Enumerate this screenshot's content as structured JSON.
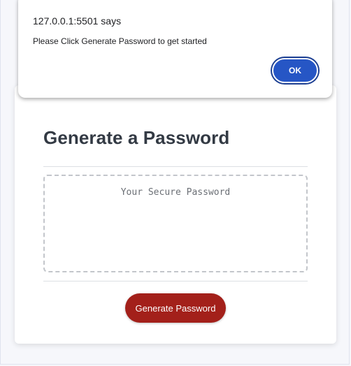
{
  "dialog": {
    "origin": "127.0.0.1:5501 says",
    "message": "Please Click Generate Password to get started",
    "ok_label": "OK"
  },
  "card": {
    "title": "Generate a Password",
    "password_placeholder": "Your Secure Password",
    "generate_label": "Generate Password"
  },
  "colors": {
    "generate_button": "#a3201a",
    "ok_button": "#2656c5",
    "title_text": "#333a44"
  }
}
